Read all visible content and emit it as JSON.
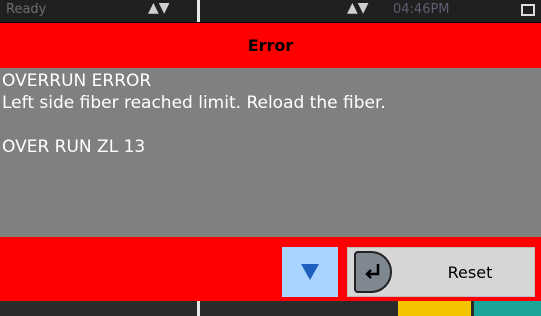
{
  "status_bar": {
    "left_text": "Ready",
    "arrows_left": "▲▼",
    "arrows_right": "▲▼",
    "time": "04:46PM"
  },
  "dialog": {
    "title": "Error",
    "message_lines": [
      "OVERRUN ERROR",
      "Left side fiber reached limit. Reload the fiber.",
      "",
      "OVER RUN ZL 13"
    ],
    "reset_label": "Reset",
    "scroll_icon": "triangle-down-icon",
    "enter_icon": "enter-return-icon"
  },
  "colors": {
    "title_bar": "#ff0000",
    "dialog_body": "#808080",
    "footer": "#ff0000",
    "scroll_button": "#a9d4ff",
    "reset_button": "#d6d6d6",
    "bottom_yellow": "#f5c400",
    "bottom_teal": "#1aa59a"
  }
}
